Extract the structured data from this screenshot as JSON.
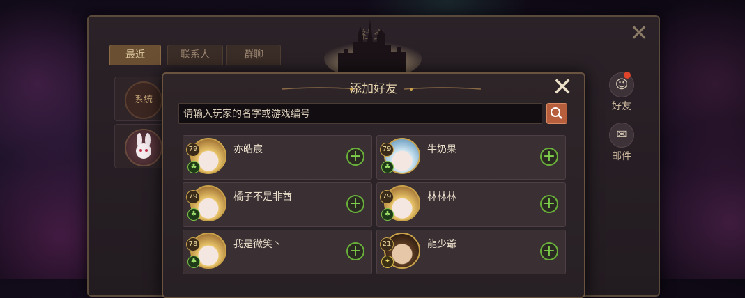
{
  "social": {
    "title": "社交",
    "tabs": [
      {
        "label": "最近",
        "active": true
      },
      {
        "label": "联系人",
        "active": false
      },
      {
        "label": "群聊",
        "active": false
      }
    ],
    "recent": [
      {
        "label": "系统"
      },
      {
        "label": ""
      }
    ],
    "side": {
      "friends_label": "好友",
      "mail_label": "邮件"
    }
  },
  "dialog": {
    "title": "添加好友",
    "search_placeholder": "请输入玩家的名字或游戏编号",
    "players": [
      {
        "name": "亦皓宸",
        "level": "79",
        "class_color": "green",
        "avatar_hair": "#e8c46a"
      },
      {
        "name": "牛奶果",
        "level": "79",
        "class_color": "green",
        "avatar_hair": "#cfe6f2"
      },
      {
        "name": "橘子不是非酋",
        "level": "79",
        "class_color": "green",
        "avatar_hair": "#e8c46a"
      },
      {
        "name": "林林林",
        "level": "79",
        "class_color": "green",
        "avatar_hair": "#e8c46a"
      },
      {
        "name": "我是微笑丶",
        "level": "78",
        "class_color": "green",
        "avatar_hair": "#e8c46a"
      },
      {
        "name": "龍少爺",
        "level": "21",
        "class_color": "yellow",
        "avatar_hair": "#5a3a22"
      }
    ]
  },
  "colors": {
    "accent_gold": "#c9a24a",
    "add_green": "#69b03a",
    "search_orange": "#b75e3c"
  },
  "icons": [
    "close-icon",
    "search-icon",
    "plus-icon",
    "friends-icon",
    "mail-icon",
    "castle-emblem"
  ]
}
